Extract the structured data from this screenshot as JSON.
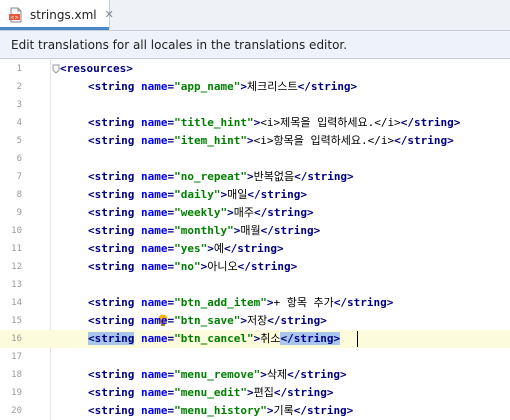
{
  "tab": {
    "title": "strings.xml",
    "icon": "xml-file-icon",
    "close": "✕"
  },
  "banner": {
    "text": "Edit translations for all locales in the translations editor."
  },
  "colors": {
    "tag": "#000080",
    "attribute": "#0000ff",
    "value": "#008000",
    "text": "#000000",
    "selection": "#a8c6ec",
    "current_line": "#fcfbdc"
  },
  "editor": {
    "root_open": "<resources>",
    "lines": [
      {
        "num": "1"
      },
      {
        "num": "2",
        "name": "app_name",
        "value": "체크리스트"
      },
      {
        "num": "3"
      },
      {
        "num": "4",
        "name": "title_hint",
        "value": "<i>제목을 입력하세요.</i>"
      },
      {
        "num": "5",
        "name": "item_hint",
        "value": "<i>항목을 입력하세요.</i>"
      },
      {
        "num": "6"
      },
      {
        "num": "7",
        "name": "no_repeat",
        "value": "반복없음"
      },
      {
        "num": "8",
        "name": "daily",
        "value": "매일"
      },
      {
        "num": "9",
        "name": "weekly",
        "value": "매주"
      },
      {
        "num": "10",
        "name": "monthly",
        "value": "매월"
      },
      {
        "num": "11",
        "name": "yes",
        "value": "예"
      },
      {
        "num": "12",
        "name": "no",
        "value": "아니오"
      },
      {
        "num": "13"
      },
      {
        "num": "14",
        "name": "btn_add_item",
        "value": "+ 항목 추가"
      },
      {
        "num": "15",
        "name": "btn_save",
        "value": "저장"
      },
      {
        "num": "16",
        "name": "btn_cancel",
        "value": "취소"
      },
      {
        "num": "17"
      },
      {
        "num": "18",
        "name": "menu_remove",
        "value": "삭제"
      },
      {
        "num": "19",
        "name": "menu_edit",
        "value": "편집"
      },
      {
        "num": "20",
        "name": "menu_history",
        "value": "기록"
      }
    ],
    "current_line": "16"
  }
}
